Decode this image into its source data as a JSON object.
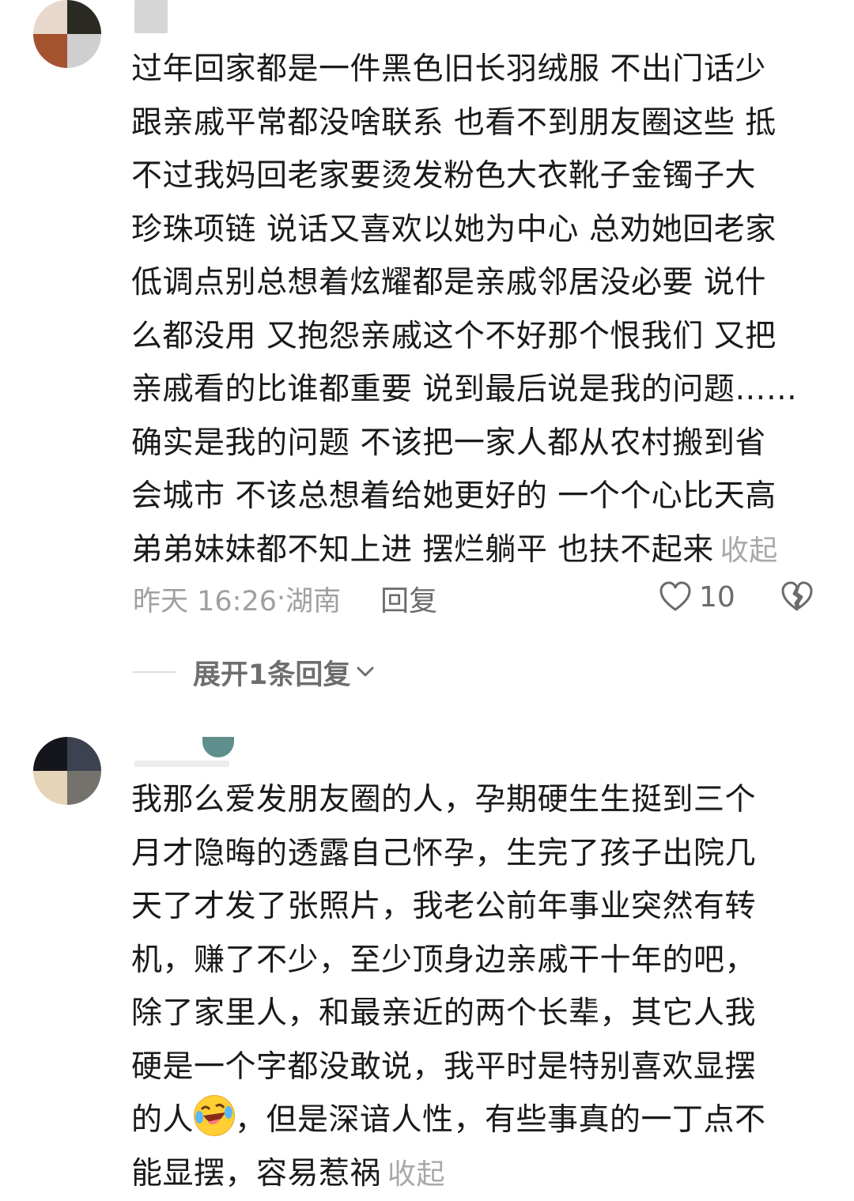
{
  "comments": [
    {
      "lines": [
        "过年回家都是一件黑色旧长羽绒服 不出门话少",
        "跟亲戚平常都没啥联系 也看不到朋友圈这些 抵",
        "不过我妈回老家要烫发粉色大衣靴子金镯子大",
        "珍珠项链 说话又喜欢以她为中心 总劝她回老家",
        "低调点别总想着炫耀都是亲戚邻居没必要 说什",
        "么都没用 又抱怨亲戚这个不好那个恨我们 又把",
        "亲戚看的比谁都重要 说到最后说是我的问题……",
        "确实是我的问题 不该把一家人都从农村搬到省",
        "会城市 不该总想着给她更好的 一个个心比天高",
        "弟弟妹妹都不知上进 摆烂躺平 也扶不起来"
      ],
      "collapse_label": "收起",
      "time": "昨天 16:26",
      "location": "湖南",
      "reply_label": "回复",
      "likes": "10",
      "expand_label": "展开1条回复",
      "avatar_colors": [
        "#e8d8cc",
        "#2a2a22",
        "#a5522f",
        "#cfcfcf"
      ]
    },
    {
      "lines": [
        "我那么爱发朋友圈的人，孕期硬生生挺到三个",
        "月才隐晦的透露自己怀孕，生完了孩子出院几",
        "天了才发了张照片，我老公前年事业突然有转",
        "机，赚了不少，至少顶身边亲戚干十年的吧，",
        "除了家里人，和最亲近的两个长辈，其它人我",
        "硬是一个字都没敢说，我平时是特别喜欢显摆"
      ],
      "line_emoji_before": "的人",
      "emoji_name": "rolling-on-floor-laughing-emoji",
      "line_emoji_after": "，但是深谙人性，有些事真的一丁点不",
      "last_line": "能显摆，容易惹祸",
      "collapse_label": "收起",
      "avatar_colors": [
        "#15151c",
        "#3c4250",
        "#e6d4b8",
        "#74726c"
      ]
    }
  ],
  "icons": {
    "like": "heart-outline-icon",
    "dislike": "broken-heart-icon",
    "expand": "chevron-down-icon"
  }
}
